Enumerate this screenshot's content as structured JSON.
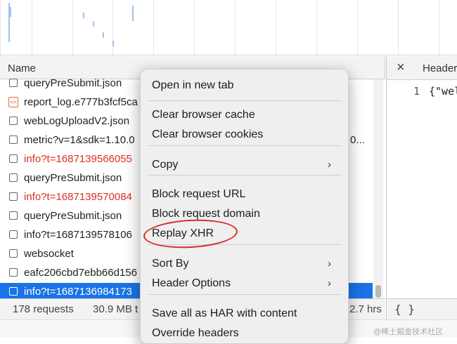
{
  "list": {
    "column_header": "Name",
    "rows": [
      {
        "name": "queryPreSubmit.json",
        "red": false,
        "icon": "checkbox"
      },
      {
        "name": "report_log.e777b3fcf5ca",
        "red": false,
        "icon": "script-file-icon"
      },
      {
        "name": "webLogUploadV2.json",
        "red": false,
        "icon": "checkbox"
      },
      {
        "name": "metric?v=1&sdk=1.10.0",
        "red": false,
        "icon": "checkbox",
        "extra": "0..."
      },
      {
        "name": "info?t=1687139566055",
        "red": true,
        "icon": "checkbox"
      },
      {
        "name": "queryPreSubmit.json",
        "red": false,
        "icon": "checkbox"
      },
      {
        "name": "info?t=1687139570084",
        "red": true,
        "icon": "checkbox"
      },
      {
        "name": "queryPreSubmit.json",
        "red": false,
        "icon": "checkbox"
      },
      {
        "name": "info?t=1687139578106",
        "red": false,
        "icon": "checkbox"
      },
      {
        "name": "websocket",
        "red": false,
        "icon": "checkbox"
      },
      {
        "name": "eafc206cbd7ebb66d156",
        "red": false,
        "icon": "checkbox"
      },
      {
        "name": "info?t=1687136984173",
        "red": false,
        "icon": "checkbox",
        "selected": true
      }
    ]
  },
  "status_bar": {
    "requests": "178 requests",
    "transferred": "30.9 MB t",
    "finish": "2.7 hrs"
  },
  "detail": {
    "close_icon": "close-icon",
    "tab_label": "Header",
    "line_number": "1",
    "code": "{\"wel",
    "pretty_print": "{ }"
  },
  "context_menu": {
    "items": [
      {
        "label": "Open in new tab"
      },
      {
        "label": "Clear browser cache"
      },
      {
        "label": "Clear browser cookies"
      },
      {
        "label": "Copy",
        "submenu": true
      },
      {
        "label": "Block request URL"
      },
      {
        "label": "Block request domain"
      },
      {
        "label": "Replay XHR",
        "highlighted": true
      },
      {
        "label": "Sort By",
        "submenu": true
      },
      {
        "label": "Header Options",
        "submenu": true
      },
      {
        "label": "Save all as HAR with content"
      },
      {
        "label": "Override headers"
      }
    ],
    "submenu_glyph": "›"
  },
  "watermark": "@稀土掘金技术社区",
  "colors": {
    "selection": "#1a73e8",
    "error_text": "#d93025",
    "annotation": "#d62d20",
    "menu_bg": "#efefef"
  }
}
